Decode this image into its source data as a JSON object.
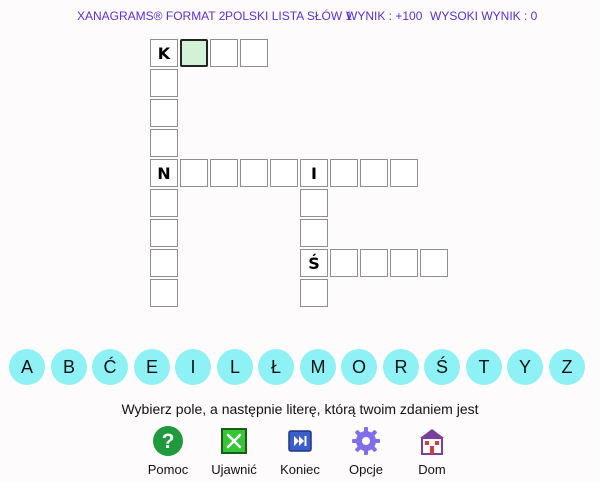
{
  "header": {
    "title": "XANAGRAMS® FORMAT 2",
    "list": "POLSKI LISTA SŁÓW 1",
    "score": "WYNIK : +100",
    "high_score": "WYSOKI WYNIK : 0"
  },
  "grid": {
    "cols": 10,
    "rows": 9,
    "cells": [
      {
        "col": 0,
        "row": 0,
        "letter": "K"
      },
      {
        "col": 1,
        "row": 0,
        "letter": "",
        "selected": true
      },
      {
        "col": 2,
        "row": 0,
        "letter": ""
      },
      {
        "col": 3,
        "row": 0,
        "letter": ""
      },
      {
        "col": 0,
        "row": 1,
        "letter": ""
      },
      {
        "col": 0,
        "row": 2,
        "letter": ""
      },
      {
        "col": 0,
        "row": 3,
        "letter": ""
      },
      {
        "col": 0,
        "row": 4,
        "letter": "N"
      },
      {
        "col": 1,
        "row": 4,
        "letter": ""
      },
      {
        "col": 2,
        "row": 4,
        "letter": ""
      },
      {
        "col": 3,
        "row": 4,
        "letter": ""
      },
      {
        "col": 4,
        "row": 4,
        "letter": ""
      },
      {
        "col": 5,
        "row": 4,
        "letter": "I"
      },
      {
        "col": 6,
        "row": 4,
        "letter": ""
      },
      {
        "col": 7,
        "row": 4,
        "letter": ""
      },
      {
        "col": 8,
        "row": 4,
        "letter": ""
      },
      {
        "col": 0,
        "row": 5,
        "letter": ""
      },
      {
        "col": 5,
        "row": 5,
        "letter": ""
      },
      {
        "col": 0,
        "row": 6,
        "letter": ""
      },
      {
        "col": 5,
        "row": 6,
        "letter": ""
      },
      {
        "col": 0,
        "row": 7,
        "letter": ""
      },
      {
        "col": 5,
        "row": 7,
        "letter": "Ś"
      },
      {
        "col": 6,
        "row": 7,
        "letter": ""
      },
      {
        "col": 7,
        "row": 7,
        "letter": ""
      },
      {
        "col": 8,
        "row": 7,
        "letter": ""
      },
      {
        "col": 9,
        "row": 7,
        "letter": ""
      },
      {
        "col": 0,
        "row": 8,
        "letter": ""
      },
      {
        "col": 5,
        "row": 8,
        "letter": ""
      }
    ]
  },
  "letters": [
    "A",
    "B",
    "Ć",
    "E",
    "I",
    "L",
    "Ł",
    "M",
    "O",
    "R",
    "Ś",
    "T",
    "Y",
    "Z"
  ],
  "instruction": "Wybierz pole, a następnie literę, którą twoim zdaniem jest",
  "buttons": [
    {
      "id": "help",
      "label": "Pomoc",
      "icon": "question-icon"
    },
    {
      "id": "reveal",
      "label": "Ujawnić",
      "icon": "reveal-x-icon"
    },
    {
      "id": "end",
      "label": "Koniec",
      "icon": "skip-end-icon"
    },
    {
      "id": "options",
      "label": "Opcje",
      "icon": "gear-icon"
    },
    {
      "id": "home",
      "label": "Dom",
      "icon": "home-icon"
    }
  ],
  "colors": {
    "header_text": "#5a2fd6",
    "letter_tile": "#8ef1f5",
    "selected_cell": "#d3f2d5",
    "help_green": "#1f9a3c",
    "reveal_green": "#35c535",
    "end_blue": "#3b5ec9",
    "options_purple": "#7f6fe8",
    "home_purple": "#7a3f9c"
  }
}
